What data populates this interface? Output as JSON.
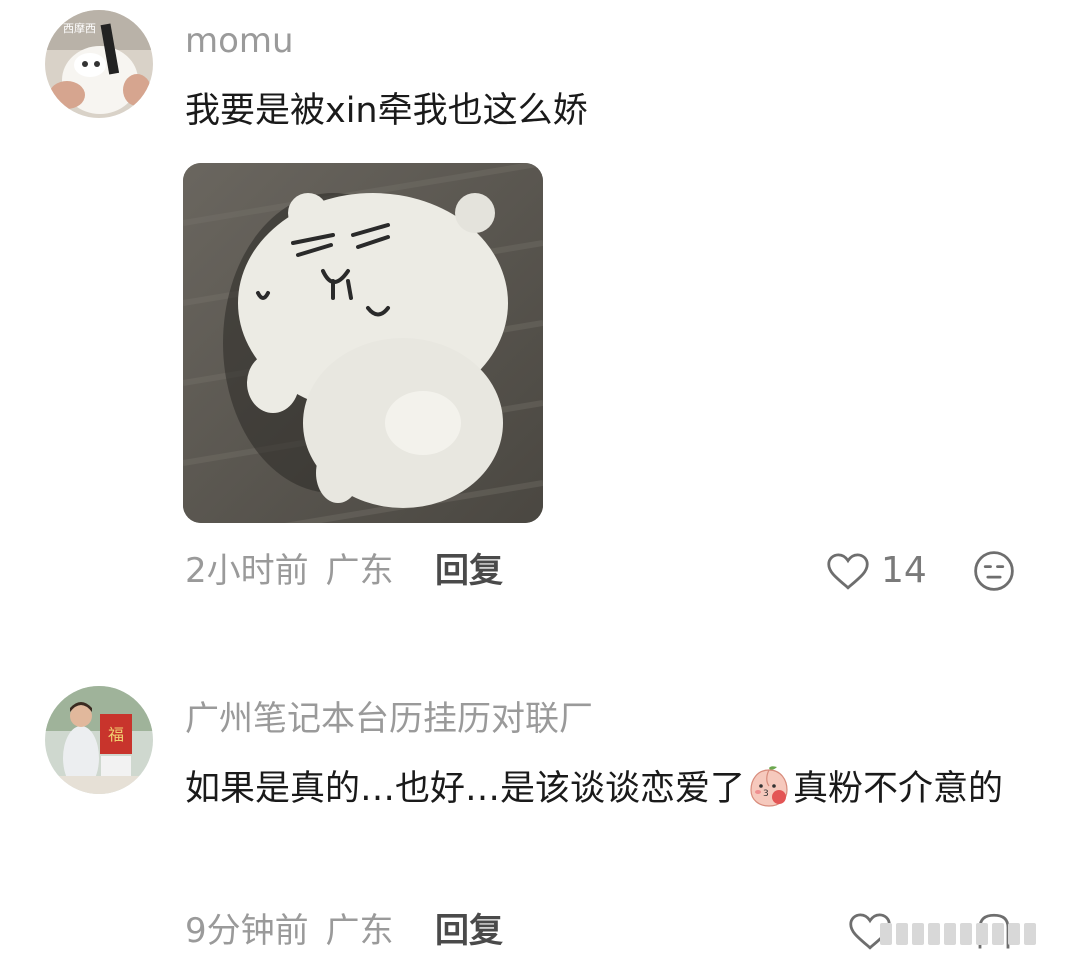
{
  "comments": [
    {
      "username": "momu",
      "avatar_label": "西摩西",
      "text": "我要是被xin牵我也这么娇",
      "has_sticker": true,
      "time": "2小时前",
      "location": "广东",
      "reply_label": "回复",
      "like_count": "14"
    },
    {
      "username": "广州笔记本台历挂历对联厂",
      "avatar_label": "福",
      "text_part1": "如果是真的…也好…是该谈谈恋爱了",
      "text_emoji": "peach-blush-emoji",
      "text_part2": "真粉不介意的",
      "time": "9分钟前",
      "location": "广东",
      "reply_label": "回复"
    }
  ],
  "icons": {
    "like": "heart-outline-icon",
    "dislike": "sad-face-icon"
  },
  "colors": {
    "secondary_text": "#9a9a9a",
    "primary_text": "#1a1a1a",
    "reply_text": "#4a4a4a"
  }
}
